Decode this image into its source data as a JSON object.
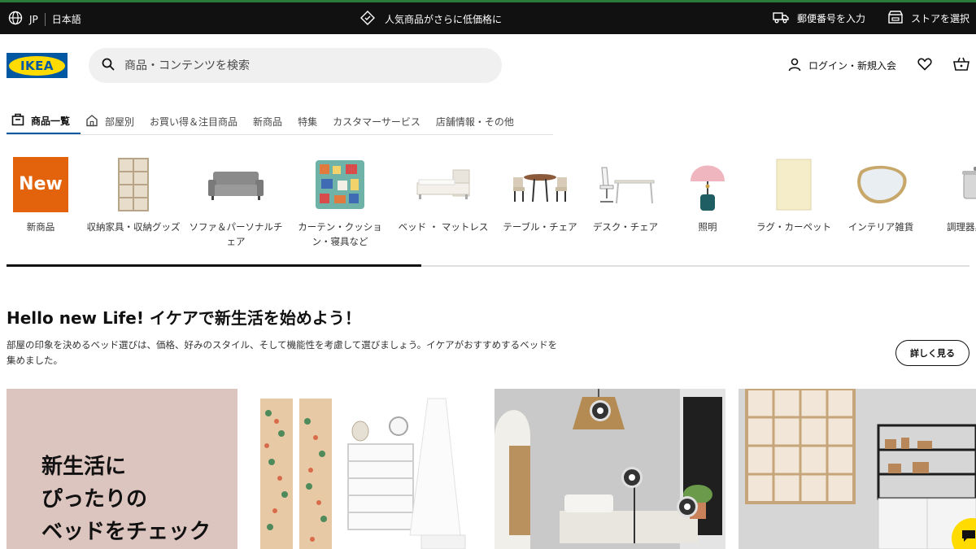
{
  "topbar": {
    "country": "JP",
    "language": "日本語",
    "promo": "人気商品がさらに低価格に",
    "postal": "郵便番号を入力",
    "store": "ストアを選択"
  },
  "header": {
    "logo_text": "IKEA",
    "search_placeholder": "商品・コンテンツを検索",
    "login": "ログイン・新規入会"
  },
  "nav": {
    "items": [
      "商品一覧",
      "部屋別",
      "お買い得＆注目商品",
      "新商品",
      "特集",
      "カスタマーサービス",
      "店舗情報・その他"
    ]
  },
  "categories": {
    "new_badge": "New",
    "items": [
      "新商品",
      "収納家具・収納グッズ",
      "ソファ＆パーソナルチェア",
      "カーテン・クッション・寝具など",
      "ベッド ・ マットレス",
      "テーブル・チェア",
      "デスク・チェア",
      "照明",
      "ラグ・カーペット",
      "インテリア雑貨",
      "調理器具"
    ]
  },
  "hero": {
    "title": "Hello new Life! イケアで新生活を始めよう！",
    "description": "部屋の印象を決めるベッド選びは、価格、好みのスタイル、そして機能性を考慮して選びましょう。イケアがおすすめするベッドを集めました。",
    "button": "詳しく見る"
  },
  "tiles": {
    "promo_text": "新生活に\nぴったりの\nベッドをチェック"
  },
  "colors": {
    "brand_blue": "#0058a3",
    "brand_yellow": "#ffdb00",
    "new_orange": "#e3630c",
    "promo_pink": "#ddc5bf"
  }
}
